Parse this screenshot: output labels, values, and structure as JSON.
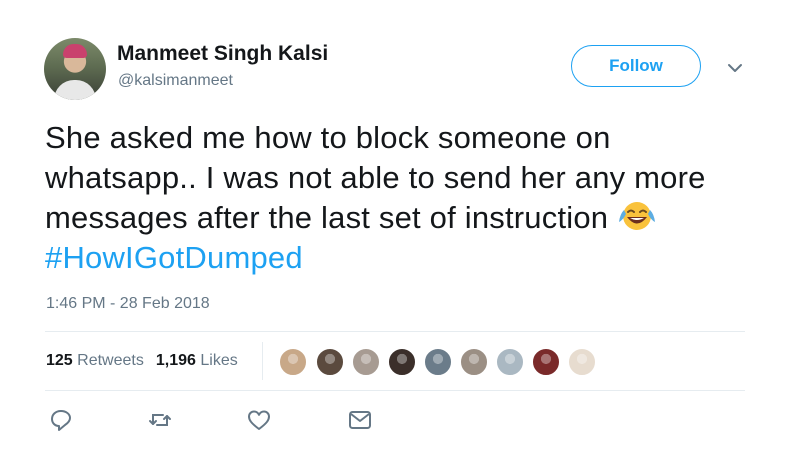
{
  "author": {
    "name": "Manmeet Singh Kalsi",
    "handle": "@kalsimanmeet"
  },
  "follow_label": "Follow",
  "tweet": {
    "text": "She asked me how to block someone  on whatsapp.. I was not able to send her any more messages after the last set of instruction",
    "emoji": "face-with-tears-of-joy",
    "hashtag": "#HowIGotDumped"
  },
  "timestamp": "1:46 PM - 28 Feb 2018",
  "stats": {
    "retweets_count": "125",
    "retweets_label": "Retweets",
    "likes_count": "1,196",
    "likes_label": "Likes"
  },
  "liker_avatar_colors": [
    "#c8a888",
    "#5b4a3e",
    "#a79b92",
    "#3b2f2a",
    "#6b7c8a",
    "#9b8f84",
    "#aab8c2",
    "#7a2a2a",
    "#e7dccf"
  ],
  "actions": {
    "reply": "reply-icon",
    "retweet": "retweet-icon",
    "like": "heart-icon",
    "message": "message-icon"
  },
  "colors": {
    "accent": "#1da1f2",
    "text": "#14171a",
    "secondary": "#657786"
  }
}
